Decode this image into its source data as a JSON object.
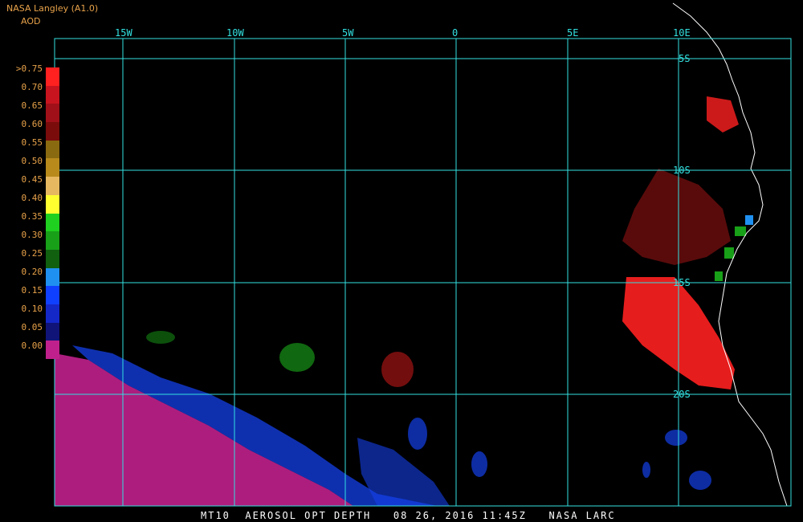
{
  "header": {
    "source": "NASA Langley (A1.0)",
    "product": "AOD"
  },
  "legend": {
    "labels": [
      ">0.75",
      "0.70",
      "0.65",
      "0.60",
      "0.55",
      "0.50",
      "0.45",
      "0.40",
      "0.35",
      "0.30",
      "0.25",
      "0.20",
      "0.15",
      "0.10",
      "0.05",
      "0.00"
    ],
    "colors": [
      "#ff2020",
      "#c8141e",
      "#a01018",
      "#7a0c0c",
      "#8a6a10",
      "#b88a1c",
      "#e6b860",
      "#ffff30",
      "#20d020",
      "#18a018",
      "#106010",
      "#2090f0",
      "#1040ff",
      "#1428c8",
      "#101478",
      "#c0208c"
    ]
  },
  "grid": {
    "lon_labels": [
      "15W",
      "10W",
      "5W",
      "0",
      "5E",
      "10E"
    ],
    "lat_labels": [
      "5S",
      "10S",
      "15S",
      "20S"
    ]
  },
  "footer": "MT10  AEROSOL OPT DEPTH   08 26, 2016 11:45Z   NASA LARC",
  "colors": {
    "grid": "#33e0e0",
    "coast": "#ffffff",
    "label": "#e8a24a"
  }
}
